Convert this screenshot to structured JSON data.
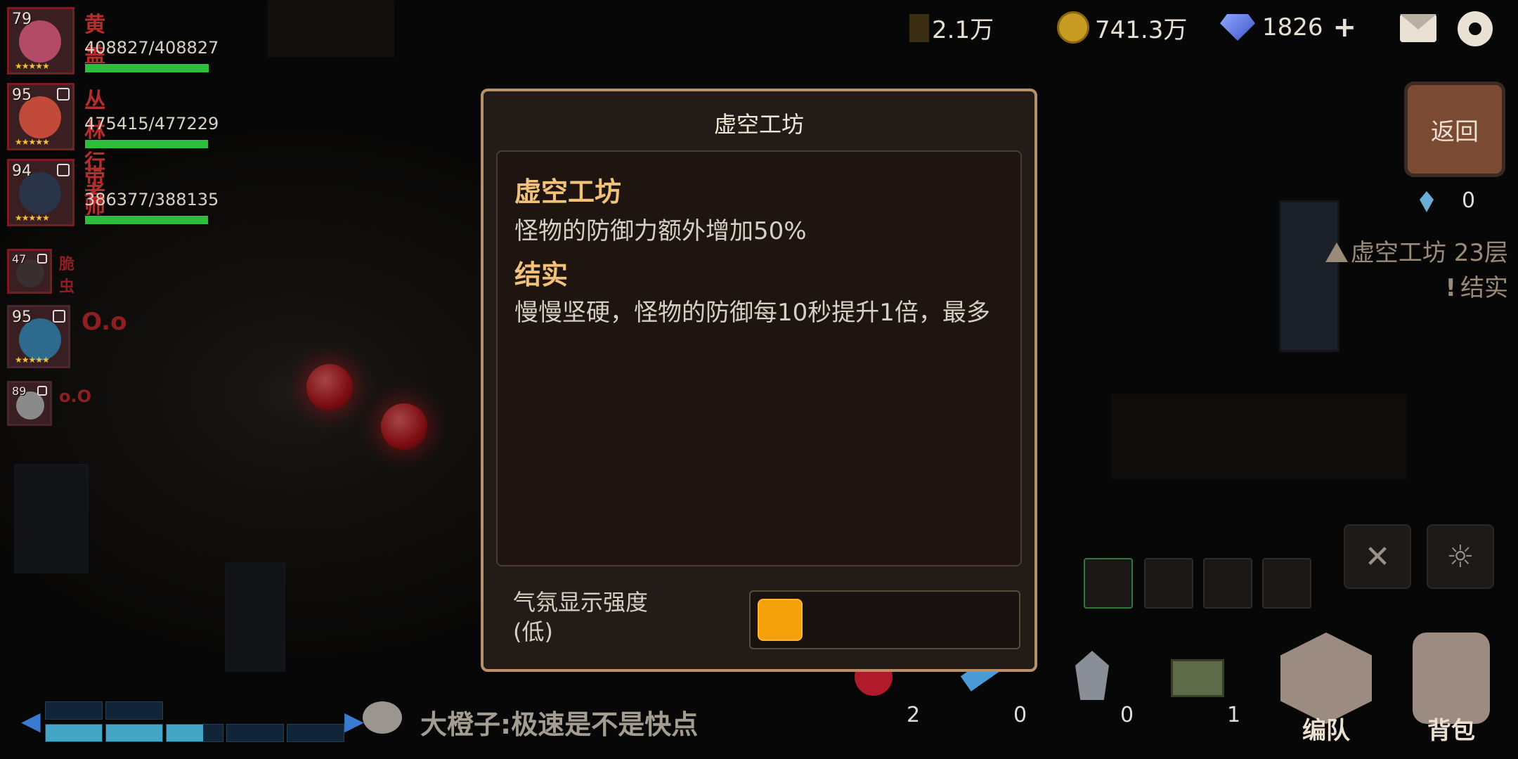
{
  "party": [
    {
      "level": "79",
      "name": "黄盖",
      "hp": "408827/408827",
      "hp_ratio": 1.0,
      "locked": false
    },
    {
      "level": "95",
      "name": "丛林行者",
      "hp": "475415/477229",
      "hp_ratio": 0.996,
      "locked": true
    },
    {
      "level": "94",
      "name": "带师",
      "hp": "386377/388135",
      "hp_ratio": 0.995,
      "locked": true
    },
    {
      "level": "47",
      "name": "脆虫",
      "locked": true
    },
    {
      "level": "95",
      "name": "O.o",
      "locked": true
    },
    {
      "level": "89",
      "name": "o.O",
      "locked": true
    }
  ],
  "stars": "★★★★★",
  "topbar": {
    "wheat": "2.1万",
    "gold": "741.3万",
    "diamonds": "1826",
    "plus": "+"
  },
  "dialog": {
    "title": "虚空工坊",
    "section1_title": "虚空工坊",
    "section1_text": "怪物的防御力额外增加50%",
    "section2_title": "结实",
    "section2_text": "慢慢坚硬，怪物的防御每10秒提升1倍，最多",
    "ambience_label_line1": "气氛显示强度",
    "ambience_label_line2": "(低)",
    "ambience_level": 0
  },
  "right": {
    "back_label": "返回",
    "crystal_count": "0",
    "zone_name": "虚空工坊 23层",
    "zone_modifier": "结实"
  },
  "items": [
    {
      "name": "red-potion",
      "count": "2"
    },
    {
      "name": "blue-scroll",
      "count": "0"
    },
    {
      "name": "stone",
      "count": "0"
    },
    {
      "name": "treasure-chest",
      "count": "1"
    }
  ],
  "buttons": {
    "formation": "编队",
    "backpack": "背包"
  },
  "chat": {
    "text": "大橙子:极速是不是快点"
  },
  "colors": {
    "accent_orange": "#f5a10c",
    "dialog_heading": "#f2c27a",
    "enemy_red": "#c0151d",
    "hp_green": "#2bbf3b"
  }
}
